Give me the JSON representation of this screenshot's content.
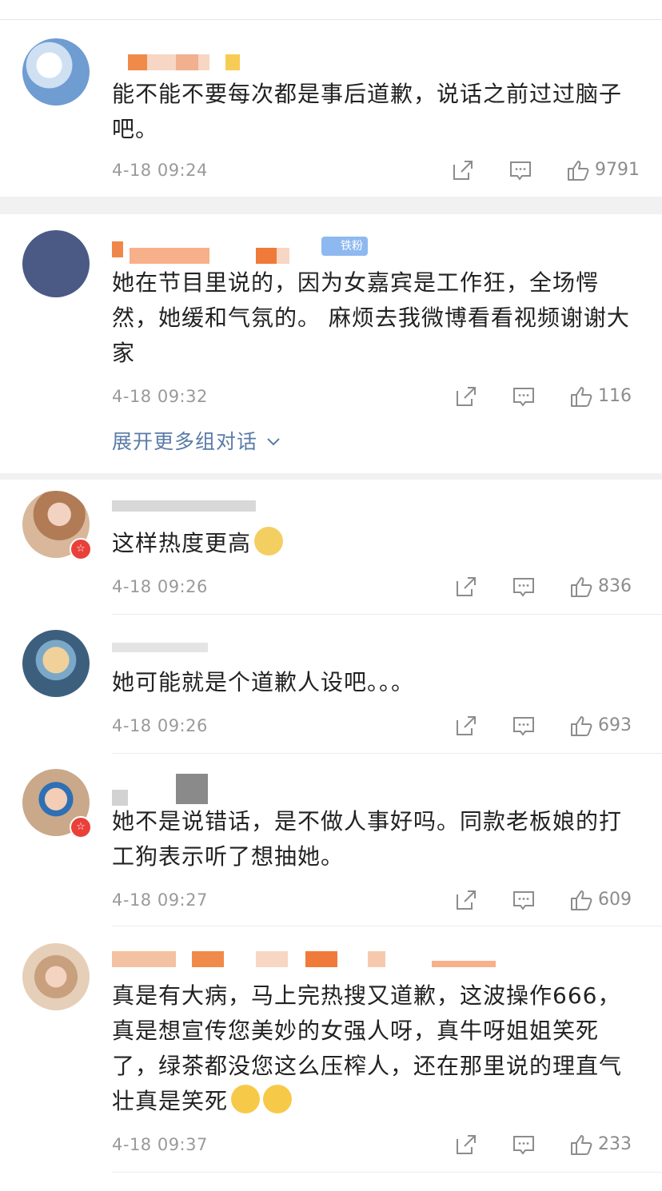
{
  "comments": [
    {
      "text": "能不能不要每次都是事后道歉，说话之前过过脑子吧。",
      "time": "4-18 09:24",
      "likes": "9791",
      "verified": false
    },
    {
      "text": "她在节目里说的，因为女嘉宾是工作狂，全场愕然，她缓和气氛的。 麻烦去我微博看看视频谢谢大家",
      "time": "4-18 09:32",
      "likes": "116",
      "fan_badge": "铁粉",
      "verified": false
    },
    {
      "text": "这样热度更高",
      "time": "4-18 09:26",
      "likes": "836",
      "emoji": "doge-emoji",
      "verified": true
    },
    {
      "text": "她可能就是个道歉人设吧。。。",
      "time": "4-18 09:26",
      "likes": "693",
      "verified": false
    },
    {
      "text": "她不是说错话，是不做人事好吗。同款老板娘的打工狗表示听了想抽她。",
      "time": "4-18 09:27",
      "likes": "609",
      "verified": true
    },
    {
      "text": "真是有大病，马上完热搜又道歉，这波操作666，真是想宣传您美妙的女强人呀，真牛呀姐姐笑死了，绿茶都没您这么压榨人，还在那里说的理直气壮真是笑死",
      "time": "4-18 09:37",
      "likes": "233",
      "emoji": "hug-emoji",
      "verified": false
    }
  ],
  "expand_label": "展开更多组对话",
  "icons": [
    "share-icon",
    "comment-icon",
    "like-icon",
    "chevron-down-icon",
    "verified-badge-icon"
  ],
  "colors": {
    "link": "#5a7ba8",
    "meta": "#9a9a9a",
    "fan_badge": "#8db9f0",
    "verified": "#e9403a",
    "redacted": "#f08a4b"
  }
}
